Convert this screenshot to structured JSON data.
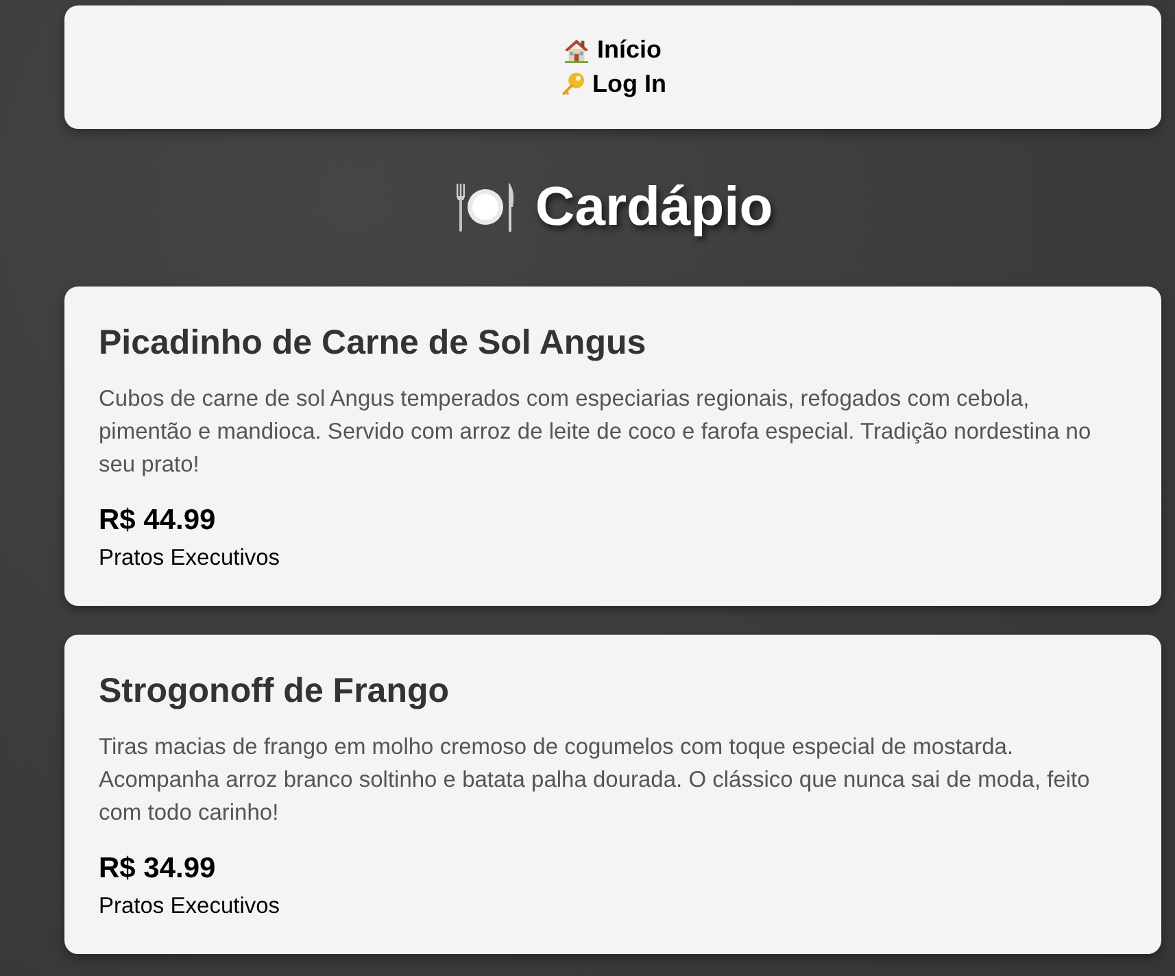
{
  "nav": {
    "links": [
      {
        "label": "Início",
        "kind": "home"
      },
      {
        "label": "Log In",
        "kind": "login"
      }
    ]
  },
  "heading": {
    "text": "Cardápio"
  },
  "menu_items": [
    {
      "name": "Picadinho de Carne de Sol Angus",
      "description": "Cubos de carne de sol Angus temperados com especiarias regionais, refogados com cebola, pimentão e mandioca. Servido com arroz de leite de coco e farofa especial. Tradição nordestina no seu prato!",
      "price": "R$ 44.99",
      "category": "Pratos Executivos"
    },
    {
      "name": "Strogonoff de Frango",
      "description": "Tiras macias de frango em molho cremoso de cogumelos com toque especial de mostarda. Acompanha arroz branco soltinho e batata palha dourada. O clássico que nunca sai de moda, feito com todo carinho!",
      "price": "R$ 34.99",
      "category": "Pratos Executivos"
    }
  ]
}
